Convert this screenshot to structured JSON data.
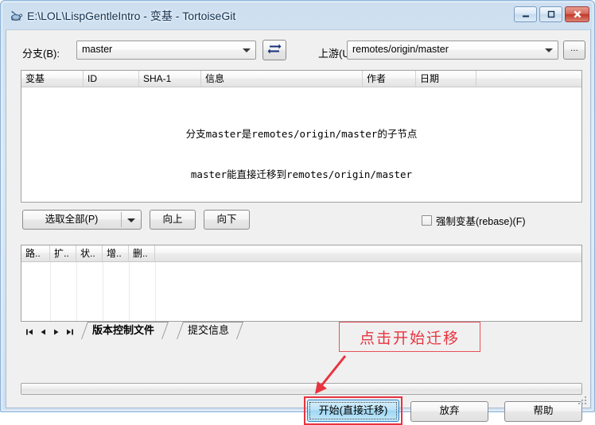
{
  "window": {
    "title": "E:\\LOL\\LispGentleIntro - 变基 - TortoiseGit",
    "icon": "tortoisegit-turtle-icon",
    "caption_buttons": {
      "minimize": "minimize-icon",
      "maximize": "maximize-icon",
      "close": "close-icon"
    },
    "accent_color": "#2f7fc4",
    "titlebar_color": "#cddff0",
    "client_color": "#f0f0f0"
  },
  "branch_row": {
    "branch_label": "分支(B):",
    "branch_value": "master",
    "swap_icon": "swap-arrows-icon",
    "upstream_label": "上游(U):",
    "upstream_value": "remotes/origin/master",
    "browse_label": "..."
  },
  "commit_list": {
    "columns": [
      "变基",
      "ID",
      "SHA-1",
      "信息",
      "作者",
      "日期",
      ""
    ],
    "rows": [],
    "empty_message_line1": "分支master是remotes/origin/master的子节点",
    "empty_message_line2": "master能直接迁移到remotes/origin/master"
  },
  "actions": {
    "select_all_label": "选取全部(P)",
    "up_label": "向上",
    "down_label": "向下",
    "force_rebase_label": "强制变基(rebase)(F)",
    "force_rebase_checked": false
  },
  "file_list": {
    "columns": [
      "路..",
      "扩..",
      "状..",
      "增..",
      "删..",
      ""
    ],
    "rows": []
  },
  "annotation": {
    "text": "点击开始迁移",
    "color": "#e8333f",
    "arrow_icon": "arrow-down-left-icon"
  },
  "tabs": {
    "nav": {
      "first": "nav-first-icon",
      "prev": "nav-prev-icon",
      "next": "nav-next-icon",
      "last": "nav-last-icon"
    },
    "items": [
      {
        "label": "版本控制文件",
        "active": true
      },
      {
        "label": "提交信息",
        "active": false
      }
    ]
  },
  "progress": {
    "value": 0,
    "max": 100
  },
  "footer": {
    "start_label": "开始(直接迁移)",
    "discard_label": "放弃",
    "help_label": "帮助"
  }
}
